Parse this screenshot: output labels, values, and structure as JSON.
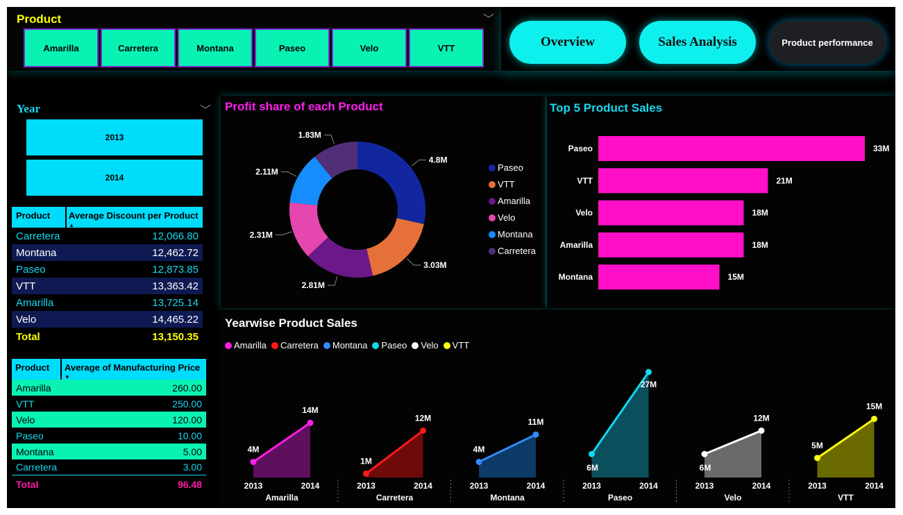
{
  "product_slicer": {
    "title": "Product",
    "items": [
      "Amarilla",
      "Carretera",
      "Montana",
      "Paseo",
      "Velo",
      "VTT"
    ]
  },
  "nav": {
    "overview": "Overview",
    "sales_analysis": "Sales Analysis",
    "product_performance": "Product performance"
  },
  "year_slicer": {
    "title": "Year",
    "items": [
      "2013",
      "2014"
    ]
  },
  "discount_table": {
    "col1": "Product",
    "col2": "Average Discount per Product",
    "rows": [
      {
        "product": "Carretera",
        "value": "12,066.80"
      },
      {
        "product": "Montana",
        "value": "12,462.72"
      },
      {
        "product": "Paseo",
        "value": "12,873.85"
      },
      {
        "product": "VTT",
        "value": "13,363.42"
      },
      {
        "product": "Amarilla",
        "value": "13,725.14"
      },
      {
        "product": "Velo",
        "value": "14,465.22"
      }
    ],
    "total_label": "Total",
    "total_value": "13,150.35"
  },
  "mfg_table": {
    "col1": "Product",
    "col2": "Average of Manufacturing Price",
    "rows": [
      {
        "product": "Amarilla",
        "value": "260.00"
      },
      {
        "product": "VTT",
        "value": "250.00"
      },
      {
        "product": "Velo",
        "value": "120.00"
      },
      {
        "product": "Paseo",
        "value": "10.00"
      },
      {
        "product": "Montana",
        "value": "5.00"
      },
      {
        "product": "Carretera",
        "value": "3.00"
      }
    ],
    "total_label": "Total",
    "total_value": "96.48"
  },
  "colors": {
    "accent_cyan": "#00dcfb",
    "slicer_green": "#09f2b4",
    "magenta": "#ff1fc8",
    "yellow": "#ffff00"
  },
  "chart_data": [
    {
      "type": "pie",
      "title": "Profit share of each Product",
      "categories": [
        "Paseo",
        "VTT",
        "Amarilla",
        "Velo",
        "Montana",
        "Carretera"
      ],
      "values": [
        4.8,
        3.03,
        2.81,
        2.31,
        2.11,
        1.83
      ],
      "labels": [
        "4.8M",
        "3.03M",
        "2.81M",
        "2.31M",
        "2.11M",
        "1.83M"
      ],
      "colors": [
        "#1226a0",
        "#e6703a",
        "#6b1889",
        "#e547ae",
        "#178cff",
        "#502f78"
      ],
      "legend": "right"
    },
    {
      "type": "bar",
      "title": "Top 5 Product Sales",
      "categories": [
        "Paseo",
        "VTT",
        "Velo",
        "Amarilla",
        "Montana"
      ],
      "values": [
        33,
        21,
        18,
        18,
        15
      ],
      "labels": [
        "33M",
        "21M",
        "18M",
        "18M",
        "15M"
      ],
      "color": "#ff0fc8"
    },
    {
      "type": "area",
      "title": "Yearwise Product Sales",
      "x": [
        "2013",
        "2014"
      ],
      "legend": "top-left",
      "series": [
        {
          "name": "Amarilla",
          "values": [
            4,
            14
          ],
          "labels": [
            "4M",
            "14M"
          ],
          "color": "#ff1fe8",
          "fill": "#5e0f5e"
        },
        {
          "name": "Carretera",
          "values": [
            1,
            12
          ],
          "labels": [
            "1M",
            "12M"
          ],
          "color": "#ff1a1a",
          "fill": "#6e0a0a"
        },
        {
          "name": "Montana",
          "values": [
            4,
            11
          ],
          "labels": [
            "4M",
            "11M"
          ],
          "color": "#2f8cff",
          "fill": "#0d3a66"
        },
        {
          "name": "Paseo",
          "values": [
            6,
            27
          ],
          "labels": [
            "6M",
            "27M"
          ],
          "color": "#11d8f0",
          "fill": "#0b4f5c"
        },
        {
          "name": "Velo",
          "values": [
            6,
            12
          ],
          "labels": [
            "6M",
            "12M"
          ],
          "color": "#ffffff",
          "fill": "#6a6a6a"
        },
        {
          "name": "VTT",
          "values": [
            5,
            15
          ],
          "labels": [
            "5M",
            "15M"
          ],
          "color": "#ffff10",
          "fill": "#6a6a00"
        }
      ]
    }
  ]
}
